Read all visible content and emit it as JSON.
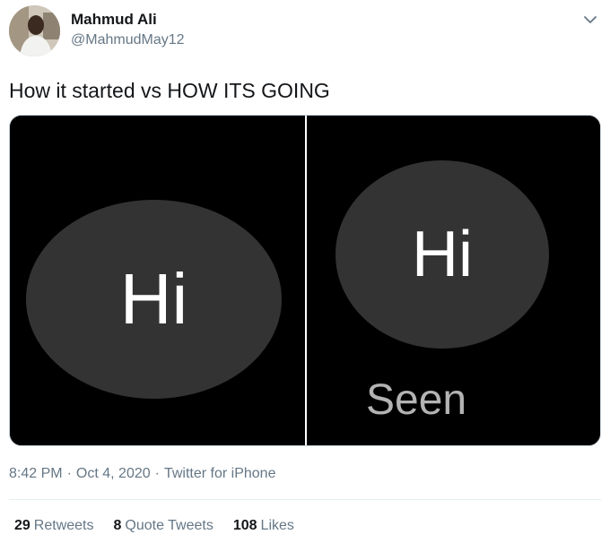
{
  "author": {
    "display_name": "Mahmud Ali",
    "handle": "@MahmudMay12",
    "avatar_icon": "profile-photo"
  },
  "tweet": {
    "text": "How it started vs HOW ITS GOING"
  },
  "media": {
    "left_bubble_text": "Hi",
    "right_bubble_text": "Hi",
    "right_status_text": "Seen",
    "bubble_color": "#333333"
  },
  "meta": {
    "time": "8:42 PM",
    "date": "Oct 4, 2020",
    "separator": "·",
    "source": "Twitter for iPhone"
  },
  "stats": {
    "retweets": {
      "count": "29",
      "label": "Retweets"
    },
    "quote_tweets": {
      "count": "8",
      "label": "Quote Tweets"
    },
    "likes": {
      "count": "108",
      "label": "Likes"
    }
  },
  "colors": {
    "text_primary": "#14171a",
    "text_secondary": "#657786",
    "divider": "#e6ecf0"
  }
}
